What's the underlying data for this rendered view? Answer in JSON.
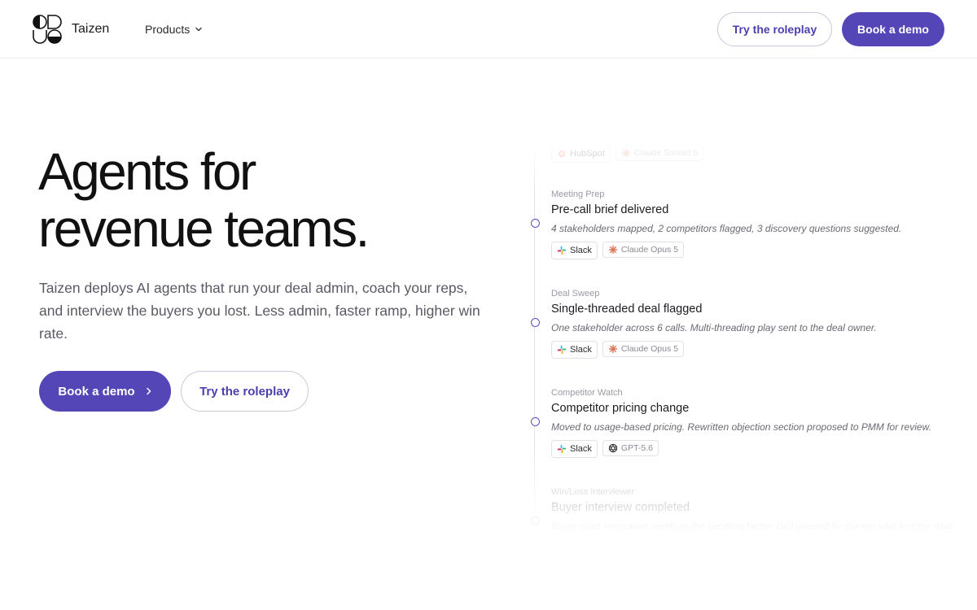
{
  "header": {
    "brand": "Taizen",
    "nav_products": "Products",
    "try_roleplay": "Try the roleplay",
    "book_demo": "Book a demo"
  },
  "hero": {
    "title_line1": "Agents for",
    "title_line2": "revenue teams.",
    "subtitle": "Taizen deploys AI agents that run your deal admin, coach your reps, and interview the buyers you lost. Less admin, faster ramp, higher win rate.",
    "primary_cta": "Book a demo",
    "secondary_cta": "Try the roleplay"
  },
  "feed": {
    "top_tags": [
      {
        "label": "HubSpot",
        "icon": "hubspot-icon"
      },
      {
        "label": "Claude Sonnet 5",
        "icon": "claude-icon"
      }
    ],
    "events": [
      {
        "agent": "Meeting Prep",
        "title": "Pre-call brief delivered",
        "description": "4 stakeholders mapped, 2 competitors flagged, 3 discovery questions suggested.",
        "channel": "Slack",
        "model": "Claude Opus 5"
      },
      {
        "agent": "Deal Sweep",
        "title": "Single-threaded deal flagged",
        "description": "One stakeholder across 6 calls. Multi-threading play sent to the deal owner.",
        "channel": "Slack",
        "model": "Claude Opus 5"
      },
      {
        "agent": "Competitor Watch",
        "title": "Competitor pricing change",
        "description": "Moved to usage-based pricing. Rewritten objection section proposed to PMM for review.",
        "channel": "Slack",
        "model": "GPT-5.6"
      },
      {
        "agent": "Win/Loss Interviewer",
        "title": "Buyer interview completed",
        "description": "Buyer cited integration depth as the deciding factor. Drill queued for the rep who lost the deal."
      }
    ]
  },
  "colors": {
    "accent": "#5546b8",
    "accent_text": "#4b3fb0",
    "outline_border": "#c9c8da"
  }
}
